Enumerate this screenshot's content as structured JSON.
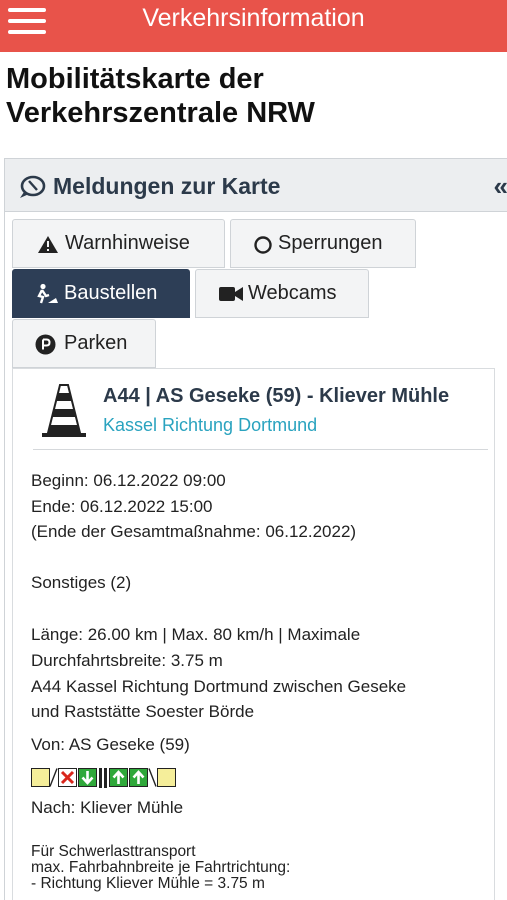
{
  "app_bar": {
    "title": "Verkehrsinformation"
  },
  "page": {
    "title_line1": "Mobilitätskarte der",
    "title_line2": "Verkehrszentrale NRW"
  },
  "panel": {
    "title": "Meldungen zur Karte",
    "collapse_glyph": "«"
  },
  "tabs": [
    {
      "label": "Warnhinweise",
      "icon": "warning-icon",
      "active": false
    },
    {
      "label": "Sperrungen",
      "icon": "circle-icon",
      "active": false
    },
    {
      "label": "Baustellen",
      "icon": "roadwork-icon",
      "active": true
    },
    {
      "label": "Webcams",
      "icon": "camera-icon",
      "active": false
    },
    {
      "label": "Parken",
      "icon": "parking-icon",
      "active": false
    }
  ],
  "item": {
    "icon": "traffic-cone-icon",
    "title": "A44 | AS Geseke (59) - Kliever Mühle",
    "direction": "Kassel Richtung Dortmund",
    "begin": "Beginn: 06.12.2022 09:00",
    "end": "Ende: 06.12.2022 15:00",
    "end_total": "(Ende der Gesamtmaßnahme: 06.12.2022)",
    "other": "Sonstiges (2)",
    "details_line1": "Länge: 26.00 km | Max. 80 km/h | Maximale",
    "details_line2": "Durchfahrtsbreite: 3.75 m",
    "details_line3": "A44 Kassel Richtung Dortmund zwischen Geseke",
    "details_line4": "und Raststätte Soester Börde",
    "from": "Von: AS Geseke (59)",
    "to": "Nach: Kliever Mühle",
    "heavy_line1": "Für Schwerlasttransport",
    "heavy_line2": "max. Fahrbahnbreite je Fahrtrichtung:",
    "heavy_line3": "- Richtung Kliever Mühle = 3.75 m"
  },
  "lane_diagram": {
    "icon": "lane-diagram-icon",
    "lanes": [
      "shoulder",
      "closed",
      "down",
      "median",
      "up",
      "up",
      "shoulder"
    ],
    "colors": {
      "shoulder": "#f5ee9a",
      "closed_x": "#d9261c",
      "arrow_bg": "#2fa83a"
    }
  }
}
